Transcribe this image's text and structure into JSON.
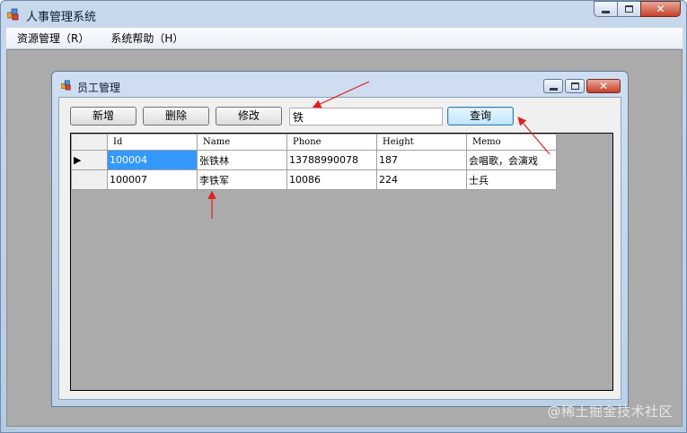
{
  "app": {
    "title": "人事管理系统"
  },
  "menu": {
    "items": [
      {
        "label": "资源管理（R）"
      },
      {
        "label": "系统帮助（H）"
      }
    ]
  },
  "child": {
    "title": "员工管理"
  },
  "toolbar": {
    "add_label": "新增",
    "delete_label": "删除",
    "edit_label": "修改",
    "search_value": "铁",
    "query_label": "查询"
  },
  "grid": {
    "columns": [
      "Id",
      "Name",
      "Phone",
      "Height",
      "Memo"
    ],
    "rows": [
      {
        "id": "100004",
        "name": "张铁林",
        "phone": "13788990078",
        "height": "187",
        "memo": "会唱歌，会演戏",
        "current": true
      },
      {
        "id": "100007",
        "name": "李铁军",
        "phone": "10086",
        "height": "224",
        "memo": "士兵",
        "current": false
      }
    ]
  },
  "watermark": "@稀土掘金技术社区",
  "colors": {
    "selection": "#3399ff",
    "arrow": "#e02020",
    "mdi_background": "#ababab"
  },
  "icons": [
    "app-icon",
    "minimize-icon",
    "maximize-icon",
    "close-icon",
    "row-pointer-icon"
  ]
}
